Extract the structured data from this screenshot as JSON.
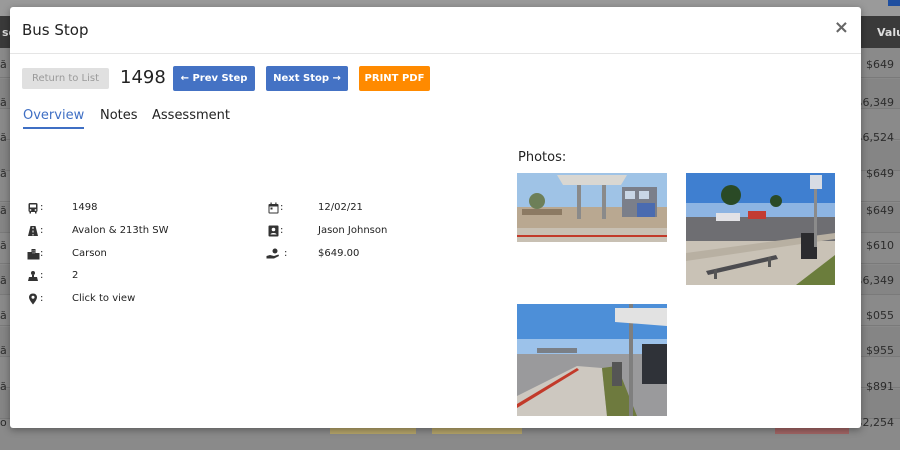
{
  "background": {
    "header_cells": [
      "se",
      "Valu"
    ],
    "values": [
      "$649",
      "$6,349",
      "$6,524",
      "$649",
      "$649",
      "$610",
      "$6,349",
      "$055",
      "$955",
      "$891",
      "$2,254"
    ],
    "left_fragments": [
      "ă",
      "ă",
      "ă",
      "ă",
      "ă",
      "ă",
      "ă",
      "ă",
      "ă",
      "ă",
      "o"
    ]
  },
  "modal": {
    "title": "Bus Stop",
    "close_symbol": "×"
  },
  "toolbar": {
    "return_label": "Return to List",
    "stop_id": "1498",
    "prev_label": "← Prev Step",
    "next_label": "Next Stop →",
    "print_label": "PRINT PDF"
  },
  "tabs": [
    {
      "label": "Overview",
      "active": true
    },
    {
      "label": "Notes",
      "active": false
    },
    {
      "label": "Assessment",
      "active": false
    }
  ],
  "details_left": [
    {
      "icon": "bus-icon",
      "value": "1498"
    },
    {
      "icon": "road-icon",
      "value": "Avalon & 213th SW"
    },
    {
      "icon": "city-icon",
      "value": "Carson"
    },
    {
      "icon": "district-icon",
      "value": "2"
    },
    {
      "icon": "map-marker-icon",
      "value": "Click to view"
    }
  ],
  "details_right": [
    {
      "icon": "calendar-icon",
      "value": "12/02/21"
    },
    {
      "icon": "contact-card-icon",
      "value": "Jason Johnson"
    },
    {
      "icon": "money-hand-icon",
      "value": "$649.00"
    }
  ],
  "photos": {
    "title": "Photos:"
  },
  "colors": {
    "primary": "#4472c4",
    "print": "#ff8a00",
    "active_tab": "#3f6fc4"
  }
}
